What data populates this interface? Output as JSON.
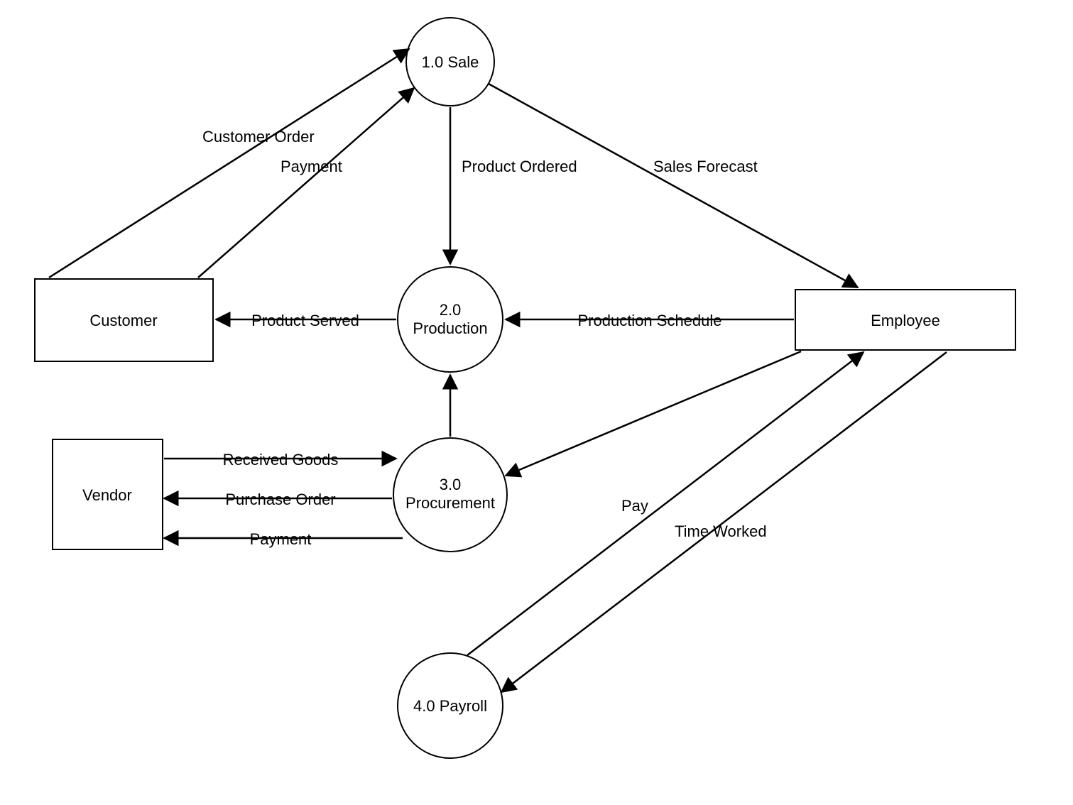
{
  "nodes": {
    "customer": "Customer",
    "vendor": "Vendor",
    "employee": "Employee",
    "sale": "1.0 Sale",
    "production_top": "2.0",
    "production_bottom": "Production",
    "procurement_top": "3.0",
    "procurement_bottom": "Procurement",
    "payroll": "4.0 Payroll"
  },
  "edges": {
    "customer_order": "Customer Order",
    "payment_to_sale": "Payment",
    "product_ordered": "Product Ordered",
    "sales_forecast": "Sales Forecast",
    "product_served": "Product Served",
    "production_schedule": "Production Schedule",
    "received_goods": "Received Goods",
    "purchase_order": "Purchase Order",
    "payment_to_vendor": "Payment",
    "pay": "Pay",
    "time_worked": "Time Worked"
  }
}
